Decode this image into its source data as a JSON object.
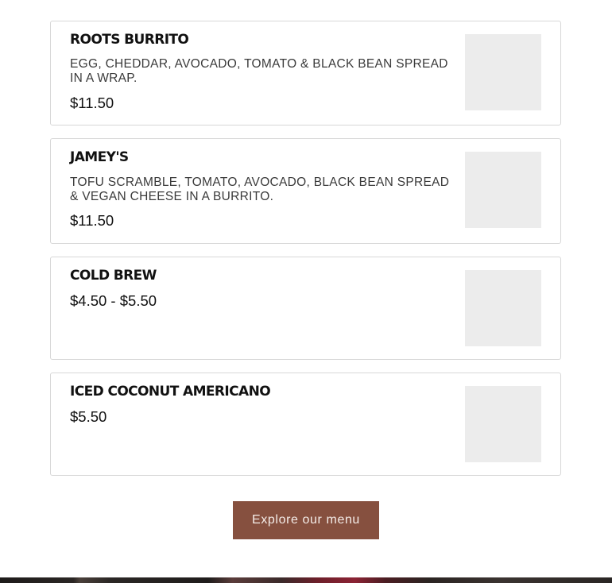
{
  "menu_items": [
    {
      "name": "ROOTS BURRITO",
      "description": "EGG, CHEDDAR, AVOCADO, TOMATO & BLACK BEAN SPREAD IN A WRAP.",
      "price": "$11.50"
    },
    {
      "name": "JAMEY'S",
      "description": "TOFU SCRAMBLE, TOMATO, AVOCADO, BLACK BEAN SPREAD & VEGAN CHEESE IN A BURRITO.",
      "price": "$11.50"
    },
    {
      "name": "COLD BREW",
      "description": "",
      "price": "$4.50 - $5.50"
    },
    {
      "name": "ICED COCONUT AMERICANO",
      "description": "",
      "price": "$5.50"
    }
  ],
  "cta": {
    "label": "Explore our menu"
  },
  "colors": {
    "button_bg": "#86503f",
    "card_border": "#d7d7d7",
    "thumb_placeholder": "#ececec"
  }
}
